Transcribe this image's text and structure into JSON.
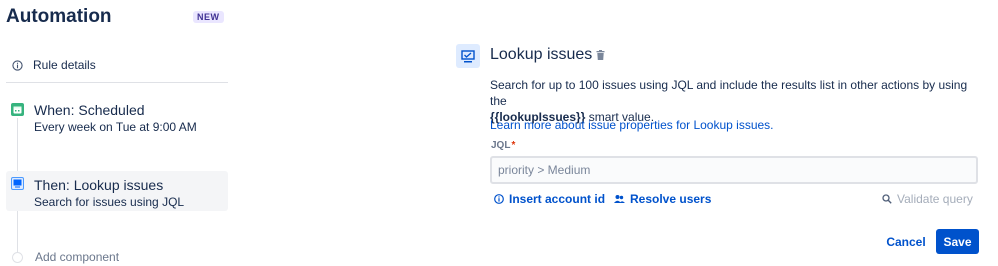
{
  "app": {
    "title": "Automation",
    "badge": "NEW"
  },
  "sidebar": {
    "rule_details": "Rule details",
    "steps": [
      {
        "title": "When: Scheduled",
        "subtitle": "Every week on Tue at 9:00 AM",
        "icon": "calendar-icon",
        "icon_color": "#36b37e"
      },
      {
        "title": "Then: Lookup issues",
        "subtitle": "Search for issues using JQL",
        "icon": "monitor-icon",
        "icon_color": "#0065ff"
      }
    ],
    "add_component": "Add component"
  },
  "panel": {
    "title": "Lookup issues",
    "description_prefix": "Search for up to 100 issues using JQL and include the results list in other actions by using the",
    "description_smart_value": "{{lookupIssues}}",
    "description_suffix": " smart value.",
    "learn_more": "Learn more about issue properties for Lookup issues.",
    "jql_label": "JQL",
    "jql_required_mark": "*",
    "jql_placeholder": "priority > Medium",
    "insert_account_id": "Insert account id",
    "resolve_users": "Resolve users",
    "validate_query": "Validate query",
    "cancel": "Cancel",
    "save": "Save"
  },
  "colors": {
    "accent": "#0052cc",
    "badge_bg": "#eae6ff",
    "badge_text": "#403294",
    "required": "#de350b"
  }
}
